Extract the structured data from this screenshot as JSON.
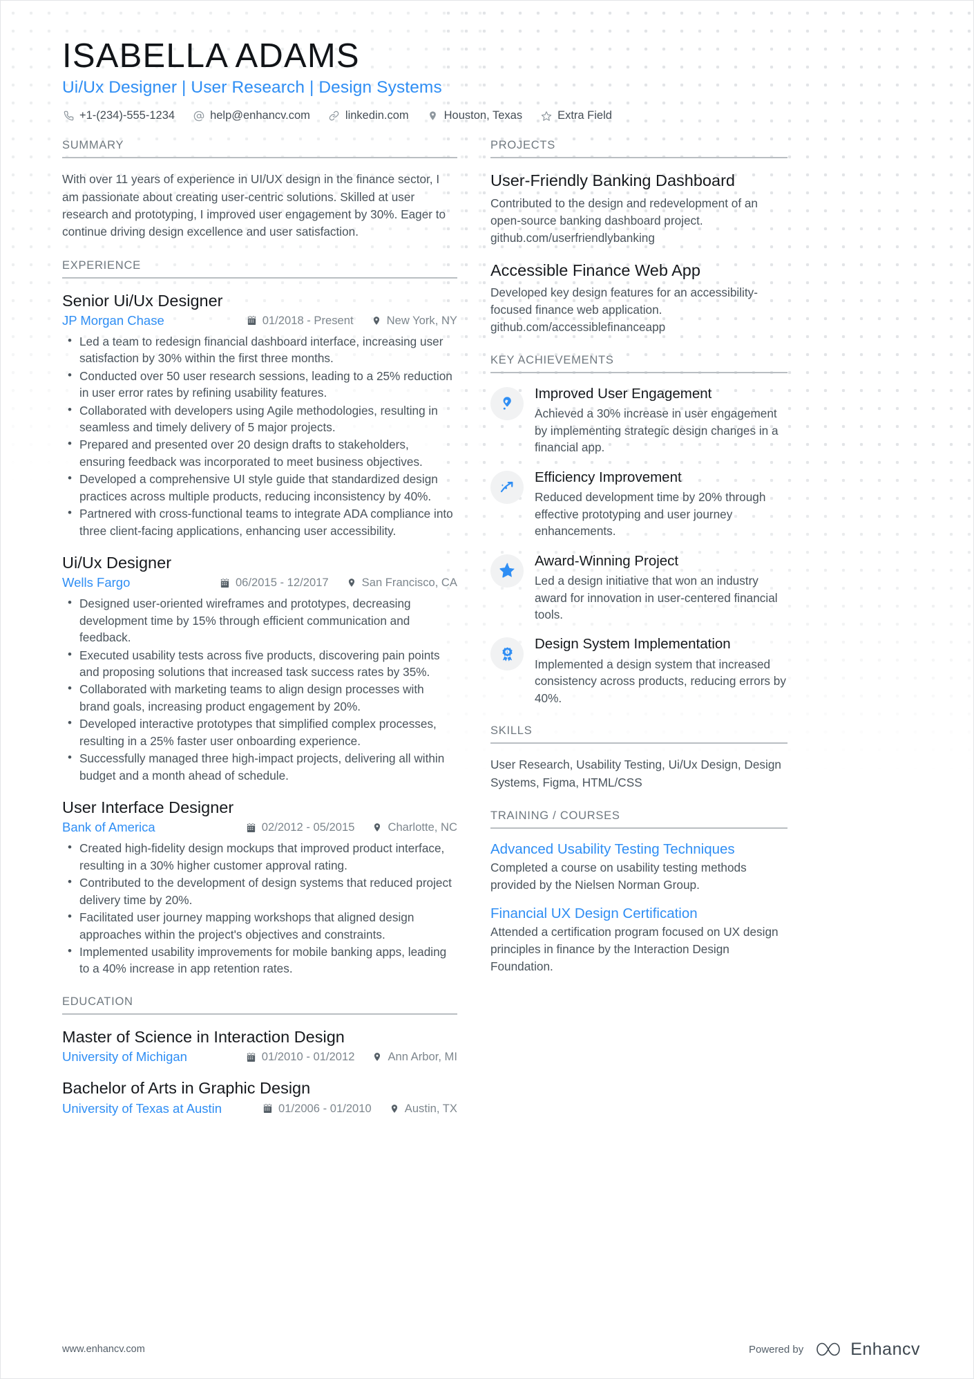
{
  "colors": {
    "accent": "#2f8ef4",
    "heading": "#16191d",
    "body": "#4a545c",
    "muted": "#7d868d",
    "rule": "#b9bec2",
    "badge_bg": "#f1f2f3"
  },
  "header": {
    "name": "ISABELLA ADAMS",
    "headline": "Ui/Ux Designer | User Research | Design Systems",
    "contacts": [
      {
        "icon": "phone-icon",
        "text": "+1-(234)-555-1234"
      },
      {
        "icon": "email-icon",
        "text": "help@enhancv.com"
      },
      {
        "icon": "link-icon",
        "text": "linkedin.com"
      },
      {
        "icon": "location-icon",
        "text": "Houston, Texas"
      },
      {
        "icon": "star-icon",
        "text": "Extra Field"
      }
    ]
  },
  "left": {
    "summary": {
      "title": "SUMMARY",
      "text": "With over 11 years of experience in UI/UX design in the finance sector, I am passionate about creating user-centric solutions. Skilled at user research and prototyping, I improved user engagement by 30%. Eager to continue driving design excellence and user satisfaction."
    },
    "experience": {
      "title": "EXPERIENCE",
      "entries": [
        {
          "role": "Senior Ui/Ux Designer",
          "org": "JP Morgan Chase",
          "dates": "01/2018 - Present",
          "location": "New York, NY",
          "bullets": [
            "Led a team to redesign financial dashboard interface, increasing user satisfaction by 30% within the first three months.",
            "Conducted over 50 user research sessions, leading to a 25% reduction in user error rates by refining usability features.",
            "Collaborated with developers using Agile methodologies, resulting in seamless and timely delivery of 5 major projects.",
            "Prepared and presented over 20 design drafts to stakeholders, ensuring feedback was incorporated to meet business objectives.",
            "Developed a comprehensive UI style guide that standardized design practices across multiple products, reducing inconsistency by 40%.",
            "Partnered with cross-functional teams to integrate ADA compliance into three client-facing applications, enhancing user accessibility."
          ]
        },
        {
          "role": "Ui/Ux Designer",
          "org": "Wells Fargo",
          "dates": "06/2015 - 12/2017",
          "location": "San Francisco, CA",
          "bullets": [
            "Designed user-oriented wireframes and prototypes, decreasing development time by 15% through efficient communication and feedback.",
            "Executed usability tests across five products, discovering pain points and proposing solutions that increased task success rates by 35%.",
            "Collaborated with marketing teams to align design processes with brand goals, increasing product engagement by 20%.",
            "Developed interactive prototypes that simplified complex processes, resulting in a 25% faster user onboarding experience.",
            "Successfully managed three high-impact projects, delivering all within budget and a month ahead of schedule."
          ]
        },
        {
          "role": "User Interface Designer",
          "org": "Bank of America",
          "dates": "02/2012 - 05/2015",
          "location": "Charlotte, NC",
          "bullets": [
            "Created high-fidelity design mockups that improved product interface, resulting in a 30% higher customer approval rating.",
            "Contributed to the development of design systems that reduced project delivery time by 20%.",
            "Facilitated user journey mapping workshops that aligned design approaches within the project's objectives and constraints.",
            "Implemented usability improvements for mobile banking apps, leading to a 40% increase in app retention rates."
          ]
        }
      ]
    },
    "education": {
      "title": "EDUCATION",
      "entries": [
        {
          "degree": "Master of Science in Interaction Design",
          "school": "University of Michigan",
          "dates": "01/2010 - 01/2012",
          "location": "Ann Arbor, MI"
        },
        {
          "degree": "Bachelor of Arts in Graphic Design",
          "school": "University of Texas at Austin",
          "dates": "01/2006 - 01/2010",
          "location": "Austin, TX"
        }
      ]
    }
  },
  "right": {
    "projects": {
      "title": "PROJECTS",
      "items": [
        {
          "name": "User-Friendly Banking Dashboard",
          "description": "Contributed to the design and redevelopment of an open-source banking dashboard project. github.com/userfriendlybanking"
        },
        {
          "name": "Accessible Finance Web App",
          "description": "Developed key design features for an accessibility-focused finance web application. github.com/accessiblefinanceapp"
        }
      ]
    },
    "achievements": {
      "title": "KEY ACHIEVEMENTS",
      "items": [
        {
          "icon": "thumbs-up-pin-icon",
          "name": "Improved User Engagement",
          "description": "Achieved a 30% increase in user engagement by implementing strategic design changes in a financial app."
        },
        {
          "icon": "trending-arrow-icon",
          "name": "Efficiency Improvement",
          "description": "Reduced development time by 20% through effective prototyping and user journey enhancements."
        },
        {
          "icon": "star-badge-icon",
          "name": "Award-Winning Project",
          "description": "Led a design initiative that won an industry award for innovation in user-centered financial tools."
        },
        {
          "icon": "award-ribbon-icon",
          "name": "Design System Implementation",
          "description": "Implemented a design system that increased consistency across products, reducing errors by 40%."
        }
      ]
    },
    "skills": {
      "title": "SKILLS",
      "text": "User Research, Usability Testing, Ui/Ux Design, Design Systems, Figma, HTML/CSS"
    },
    "training": {
      "title": "TRAINING / COURSES",
      "items": [
        {
          "name": "Advanced Usability Testing Techniques",
          "description": "Completed a course on usability testing methods provided by the Nielsen Norman Group."
        },
        {
          "name": "Financial UX Design Certification",
          "description": "Attended a certification program focused on UX design principles in finance by the Interaction Design Foundation."
        }
      ]
    }
  },
  "footer": {
    "url": "www.enhancv.com",
    "powered_by": "Powered by",
    "brand": "Enhancv"
  }
}
